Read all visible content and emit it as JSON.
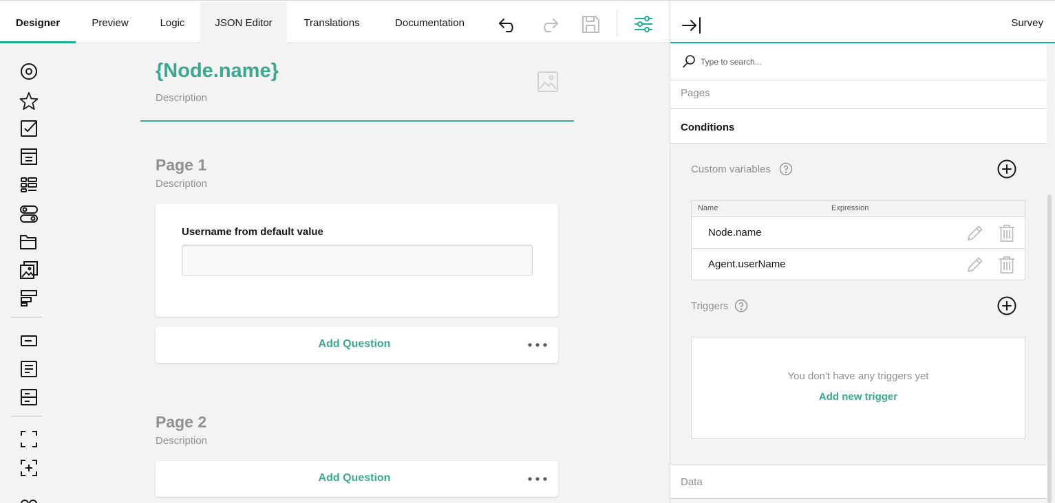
{
  "toolbar": {
    "tabs": [
      {
        "label": "Designer"
      },
      {
        "label": "Preview"
      },
      {
        "label": "Logic"
      },
      {
        "label": "JSON Editor"
      },
      {
        "label": "Translations"
      },
      {
        "label": "Documentation"
      }
    ],
    "active_tab": "Designer",
    "icons": [
      "undo-icon",
      "redo-icon",
      "save-icon",
      "settings-icon"
    ]
  },
  "toolbox": {
    "icons": [
      "radiogroup-icon",
      "rating-icon",
      "checkbox-icon",
      "dropdown-icon",
      "ranking-icon",
      "boolean-icon",
      "file-icon",
      "imagepicker-icon",
      "matrix-icon",
      "text-icon",
      "comment-icon",
      "multipletext-icon",
      "panel-icon",
      "paneldynamic-icon",
      "more-icon"
    ]
  },
  "survey": {
    "title": "{Node.name}",
    "description": "Description",
    "pages": [
      {
        "title": "Page 1",
        "description": "Description",
        "question": {
          "title": "Username from default value",
          "value": ""
        },
        "add_question_label": "Add Question"
      },
      {
        "title": "Page 2",
        "description": "Description",
        "add_question_label": "Add Question"
      }
    ]
  },
  "property_grid": {
    "title": "Survey",
    "search_placeholder": "Type to search...",
    "sections": {
      "pages": "Pages",
      "conditions": "Conditions",
      "data": "Data"
    },
    "custom_variables": {
      "label": "Custom variables",
      "columns": [
        "Name",
        "Expression"
      ],
      "rows": [
        {
          "name": "Node.name",
          "expression": ""
        },
        {
          "name": "Agent.userName",
          "expression": ""
        }
      ]
    },
    "triggers": {
      "label": "Triggers",
      "empty_text": "You don't have any triggers yet",
      "add_label": "Add new trigger"
    }
  },
  "colors": {
    "accent": "#19b394",
    "accent_text": "#3aa98f",
    "muted_text": "#909090",
    "background": "#f3f3f3"
  }
}
